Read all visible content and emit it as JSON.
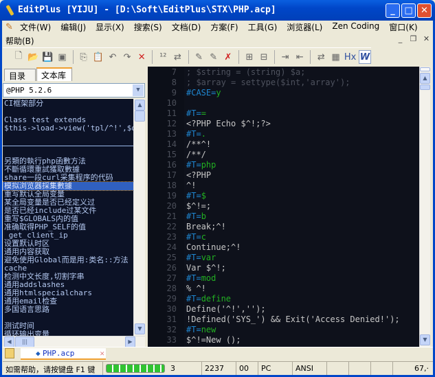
{
  "window": {
    "title": "EditPlus [YIJU] - [D:\\Soft\\EditPlus\\STX\\PHP.acp]"
  },
  "menu": [
    "文件(W)",
    "编辑(J)",
    "显示(X)",
    "搜索(S)",
    "文档(D)",
    "方案(F)",
    "工具(G)",
    "浏览器(L)",
    "Zen Coding",
    "窗口(K)"
  ],
  "menu_row2": [
    "帮助(B)"
  ],
  "toolbar": {
    "icons": [
      "new-file-icon",
      "open-folder-icon",
      "save-icon",
      "save-all-icon",
      "|",
      "copy-icon",
      "paste-icon",
      "undo-icon",
      "redo-icon",
      "delete-icon",
      "|",
      "line-number-icon",
      "sync-icon",
      "|",
      "edit-icon",
      "edit-all-icon",
      "clear-icon",
      "|",
      "expand-icon",
      "collapse-icon",
      "|",
      "indent-icon",
      "outdent-icon",
      "|",
      "swap-icon",
      "browser-icon",
      "hex-icon",
      "word-wrap-icon"
    ],
    "hex_label": "Hx",
    "wrap_label": "W"
  },
  "left_panel": {
    "tabs": [
      "目录",
      "文本库"
    ],
    "active_tab": 1,
    "combo_value": "@PHP 5.2.6",
    "items": [
      "CI框架部分",
      "",
      "Class test extends",
      "$this->load->view('tpl/^!',$data);",
      "",
      "---",
      "",
      "另類的執行php函數方法",
      "不斷循環重試獲取數據",
      "share一段curl采集程序的代码",
      "模拟浏览器採集數據",
      "重写默认全局变量",
      "某全局变量是否已经定义过",
      "是否已经include过某文件",
      "重写$GLOBALS内的值",
      "准确取得PHP_SELF的值",
      " _get_client_ip",
      "设置默认时区",
      "通用内容获取",
      "避免使用Global而是用:类名::方法",
      "cache",
      "检测中文长度,切割字串",
      "通用addslashes",
      "通用htmlspecialchars",
      "通用email检查",
      "多国语言思路",
      "",
      "测试时间",
      "循环输出变量"
    ],
    "selected_index": 10
  },
  "editor": {
    "lines": [
      {
        "n": "7",
        "parts": [
          {
            "t": "; $string = (string) $a;",
            "k": "com"
          }
        ]
      },
      {
        "n": "8",
        "parts": [
          {
            "t": "; $array = settype($int,'array');",
            "k": "com"
          }
        ]
      },
      {
        "n": "9",
        "parts": [
          {
            "t": "#CASE=",
            "k": "dir"
          },
          {
            "t": "y",
            "k": "val"
          }
        ]
      },
      {
        "n": "10",
        "parts": []
      },
      {
        "n": "11",
        "parts": [
          {
            "t": "#T=",
            "k": "dir"
          },
          {
            "t": "=",
            "k": "val"
          }
        ]
      },
      {
        "n": "12",
        "parts": [
          {
            "t": "<?PHP Echo $^!;?>",
            "k": "txt"
          }
        ]
      },
      {
        "n": "13",
        "parts": [
          {
            "t": "#T=",
            "k": "dir"
          },
          {
            "t": ".",
            "k": "val"
          }
        ]
      },
      {
        "n": "14",
        "parts": [
          {
            "t": "/**^!",
            "k": "txt"
          }
        ]
      },
      {
        "n": "15",
        "parts": [
          {
            "t": "/**/",
            "k": "txt"
          }
        ]
      },
      {
        "n": "16",
        "parts": [
          {
            "t": "#T=",
            "k": "dir"
          },
          {
            "t": "php",
            "k": "val"
          }
        ]
      },
      {
        "n": "17",
        "parts": [
          {
            "t": "<?PHP",
            "k": "txt"
          }
        ]
      },
      {
        "n": "18",
        "parts": [
          {
            "t": "^!",
            "k": "txt"
          }
        ]
      },
      {
        "n": "19",
        "parts": [
          {
            "t": "#T=",
            "k": "dir"
          },
          {
            "t": "$",
            "k": "val"
          }
        ]
      },
      {
        "n": "20",
        "parts": [
          {
            "t": "$^!=;",
            "k": "txt"
          }
        ]
      },
      {
        "n": "21",
        "parts": [
          {
            "t": "#T=",
            "k": "dir"
          },
          {
            "t": "b",
            "k": "val"
          }
        ]
      },
      {
        "n": "22",
        "parts": [
          {
            "t": "Break;^!",
            "k": "txt"
          }
        ]
      },
      {
        "n": "23",
        "parts": [
          {
            "t": "#T=",
            "k": "dir"
          },
          {
            "t": "c",
            "k": "val"
          }
        ]
      },
      {
        "n": "24",
        "parts": [
          {
            "t": "Continue;^!",
            "k": "txt"
          }
        ]
      },
      {
        "n": "25",
        "parts": [
          {
            "t": "#T=",
            "k": "dir"
          },
          {
            "t": "var",
            "k": "val"
          }
        ]
      },
      {
        "n": "26",
        "parts": [
          {
            "t": "Var $^!;",
            "k": "txt"
          }
        ]
      },
      {
        "n": "27",
        "parts": [
          {
            "t": "#T=",
            "k": "dir"
          },
          {
            "t": "mod",
            "k": "val"
          }
        ]
      },
      {
        "n": "28",
        "parts": [
          {
            "t": "% ^!",
            "k": "txt"
          }
        ]
      },
      {
        "n": "29",
        "parts": [
          {
            "t": "#T=",
            "k": "dir"
          },
          {
            "t": "define",
            "k": "val"
          }
        ]
      },
      {
        "n": "30",
        "parts": [
          {
            "t": "Define('^!','');",
            "k": "txt"
          }
        ]
      },
      {
        "n": "31",
        "parts": [
          {
            "t": "!Defined('SYS_') && Exit('Access Denied!');",
            "k": "txt"
          }
        ]
      },
      {
        "n": "32",
        "parts": [
          {
            "t": "#T=",
            "k": "dir"
          },
          {
            "t": "new",
            "k": "val"
          }
        ]
      },
      {
        "n": "33",
        "parts": [
          {
            "t": "$^!=New ();",
            "k": "txt"
          }
        ]
      }
    ]
  },
  "doc_tab": {
    "label": "PHP.acp"
  },
  "status": {
    "help": "如需帮助，请按键盘 F1 键",
    "progress": 1.0,
    "fields": [
      "3",
      "2237",
      "00",
      "PC",
      "ANSI",
      "",
      "",
      "",
      "67,·"
    ]
  },
  "colors": {
    "title_bar": "#0046c8",
    "editor_bg": "#0e111b",
    "directive": "#1f86d0",
    "value": "#22b022",
    "text": "#c8c8c8",
    "comment": "#4e525e",
    "selection": "#3060c0"
  }
}
